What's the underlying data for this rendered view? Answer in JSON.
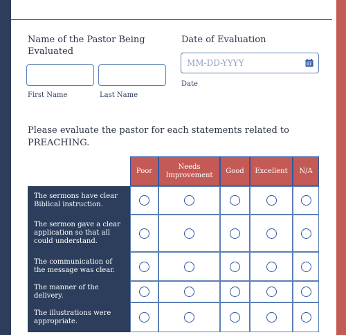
{
  "pastor_name": {
    "question": "Name of the Pastor Being Evaluated",
    "first_label": "First Name",
    "last_label": "Last Name",
    "first_value": "",
    "last_value": ""
  },
  "evaluation_date": {
    "question": "Date of Evaluation",
    "placeholder": "MM-DD-YYYY",
    "sub_label": "Date",
    "icon": "calendar-icon"
  },
  "preaching": {
    "instruction": "Please evaluate the pastor for each statements related to PREACHING.",
    "columns": [
      "Poor",
      "Needs Improvement",
      "Good",
      "Excellent",
      "N/A"
    ],
    "rows": [
      "The sermons have clear Biblical instruction.",
      "The sermon gave a clear application so that all could understand.",
      "The communication of the message was clear.",
      "The manner of the delivery.",
      "The illustrations were appropriate."
    ],
    "selected": [
      null,
      null,
      null,
      null,
      null
    ]
  },
  "colors": {
    "navy": "#2c3e5b",
    "accent_red": "#c45a55",
    "border_blue": "#5b7fb5"
  }
}
